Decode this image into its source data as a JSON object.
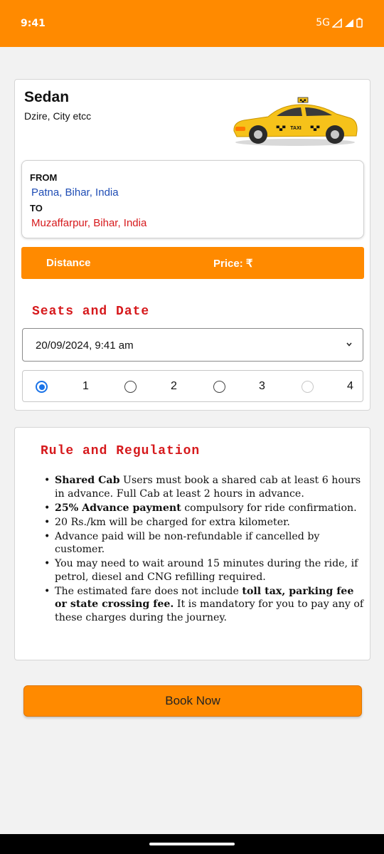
{
  "status_bar": {
    "time": "9:41",
    "network": "5G"
  },
  "vehicle": {
    "title": "Sedan",
    "subtitle": "Dzire, City etcc",
    "image_icon": "taxi-car-icon",
    "taxi_sign": "TAXI"
  },
  "route": {
    "from_label": "FROM",
    "from_value": "Patna, Bihar, India",
    "to_label": "TO",
    "to_value": "Muzaffarpur, Bihar, India"
  },
  "price_bar": {
    "distance_label": "Distance",
    "price_label": "Price: ₹"
  },
  "seats_section": {
    "title": "Seats and Date",
    "date_value": "20/09/2024, 9:41 am",
    "seats": [
      {
        "label": "1",
        "selected": true,
        "disabled": false
      },
      {
        "label": "2",
        "selected": false,
        "disabled": false
      },
      {
        "label": "3",
        "selected": false,
        "disabled": false
      },
      {
        "label": "4",
        "selected": false,
        "disabled": true
      }
    ]
  },
  "rules": {
    "title": "Rule and Regulation",
    "items": [
      {
        "bold": "Shared Cab",
        "text": " Users must book a shared cab at least 6 hours in advance. Full Cab at least 2 hours in advance."
      },
      {
        "bold": "25% Advance payment",
        "text": " compulsory for ride confirmation."
      },
      {
        "bold": "",
        "text": "20 Rs./km will be charged for extra kilometer."
      },
      {
        "bold": "",
        "text": "Advance paid will be non-refundable if cancelled by customer."
      },
      {
        "bold": "",
        "text": "You may need to wait around 15 minutes during the ride, if petrol, diesel and CNG refilling required."
      },
      {
        "pre": "The estimated fare does not include ",
        "bold": "toll tax, parking fee or state crossing fee.",
        "text": " It is mandatory for you to pay any of these charges during the journey."
      }
    ]
  },
  "actions": {
    "book_label": "Book Now"
  },
  "colors": {
    "accent": "#ff8a00",
    "from_text": "#1f4db5",
    "to_text": "#d6191c",
    "section_title": "#d6191c",
    "radio_checked": "#1a73e8"
  }
}
